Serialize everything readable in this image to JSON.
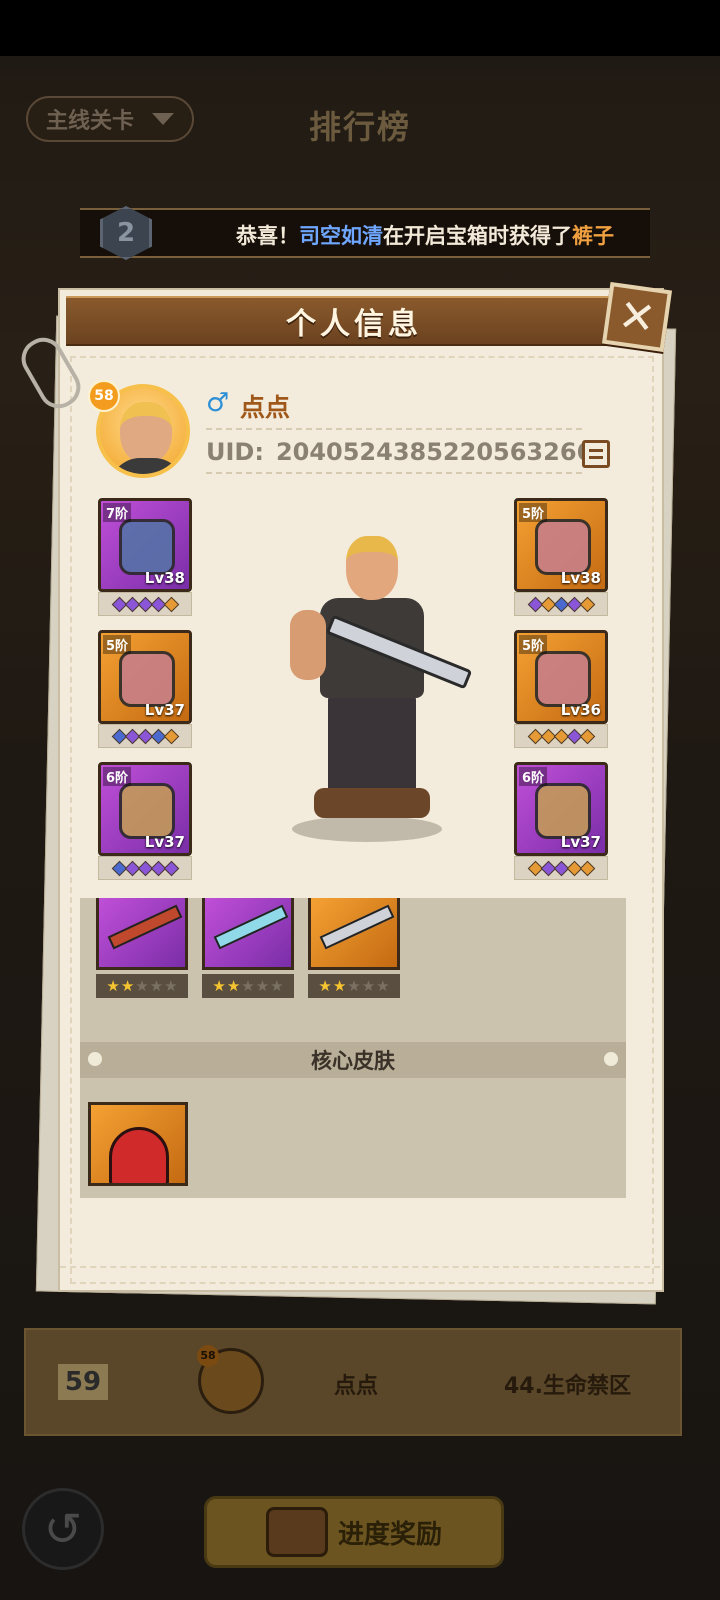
{
  "background": {
    "dropdown_label": "主线关卡",
    "title": "排行榜",
    "rank_badge": "2",
    "marquee": {
      "prefix": "恭喜！",
      "player": "司空如清",
      "middle": "在开启宝箱时获得了",
      "item": "裤子"
    },
    "row": {
      "rank": "59",
      "avatar_level": "58",
      "name": "点点",
      "stage": "44.生命禁区"
    },
    "reward_button": "进度奖励"
  },
  "popup": {
    "title": "个人信息",
    "close_icon": "close-icon",
    "profile": {
      "level": "58",
      "gender_symbol": "♂",
      "nickname": "点点",
      "uid_label": "UID:",
      "uid": "2040524385220563266"
    },
    "equipment_left": [
      {
        "tier": "7阶",
        "level": "Lv38",
        "rarity": "purple",
        "item": "helmet",
        "gems": [
          "p",
          "p",
          "p",
          "p",
          "o"
        ]
      },
      {
        "tier": "5阶",
        "level": "Lv37",
        "rarity": "orange",
        "item": "armor",
        "gems": [
          "b",
          "p",
          "p",
          "b",
          "o"
        ]
      },
      {
        "tier": "6阶",
        "level": "Lv37",
        "rarity": "purple",
        "item": "boots",
        "gems": [
          "b",
          "p",
          "p",
          "p",
          "p"
        ]
      }
    ],
    "equipment_right": [
      {
        "tier": "5阶",
        "level": "Lv38",
        "rarity": "orange",
        "item": "shoulder-pads",
        "gems": [
          "p",
          "o",
          "b",
          "p",
          "o"
        ]
      },
      {
        "tier": "5阶",
        "level": "Lv36",
        "rarity": "orange",
        "item": "pants",
        "gems": [
          "o",
          "o",
          "o",
          "p",
          "o"
        ]
      },
      {
        "tier": "6阶",
        "level": "Lv37",
        "rarity": "purple",
        "item": "gloves",
        "gems": [
          "o",
          "p",
          "p",
          "o",
          "o"
        ]
      }
    ],
    "weapons": [
      {
        "rarity": "purple",
        "stars": 2,
        "max_stars": 5
      },
      {
        "rarity": "purple",
        "stars": 2,
        "max_stars": 5
      },
      {
        "rarity": "orange",
        "stars": 2,
        "max_stars": 5
      }
    ],
    "skin_section_title": "核心皮肤",
    "skins": [
      {
        "rarity": "orange",
        "item": "red-mech-skin"
      }
    ]
  }
}
